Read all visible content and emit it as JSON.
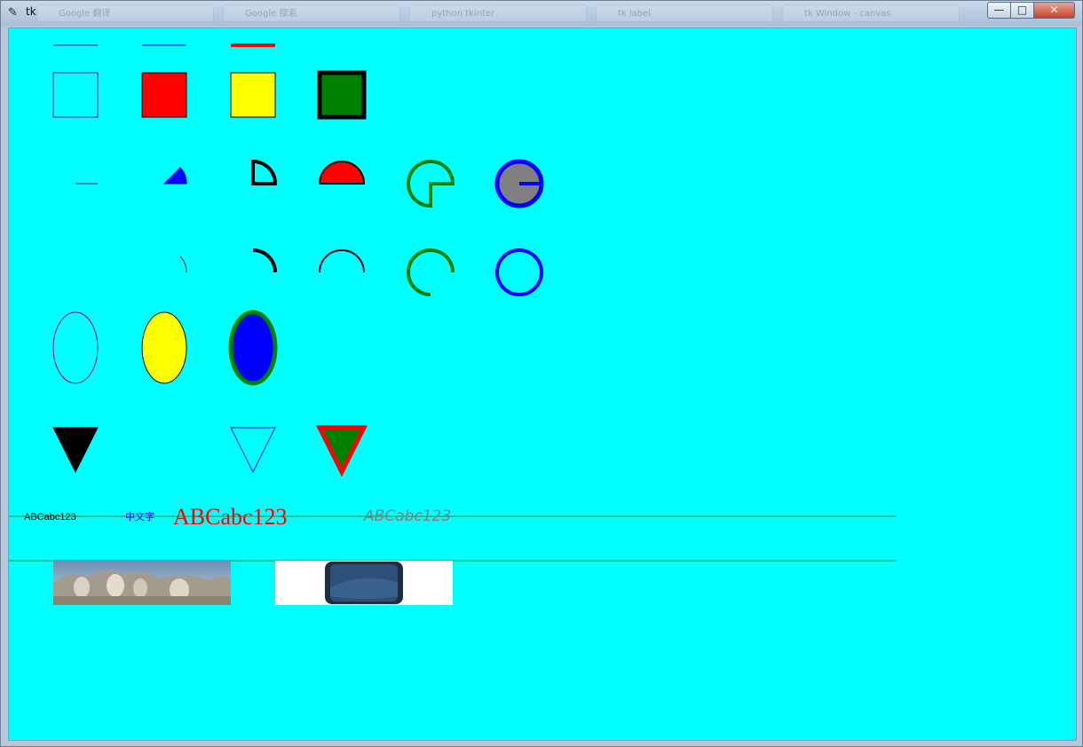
{
  "window": {
    "title": "tk",
    "icon": "feather-icon",
    "controls": {
      "minimize": "—",
      "maximize": "□",
      "close": "✕"
    },
    "background_tabs": [
      "Google 翻译",
      "Google 搜索",
      "python tkinter",
      "tk label",
      "tk Window - canvas"
    ]
  },
  "canvas": {
    "background": "#00ffff",
    "texts": {
      "small": "ABCabc123",
      "chinese": "中文字",
      "large_red": "ABCabc123",
      "italic_gray": "ABCabc123"
    },
    "images": {
      "photo1": "mount-rushmore-image",
      "photo2": "smartphone-image"
    }
  }
}
